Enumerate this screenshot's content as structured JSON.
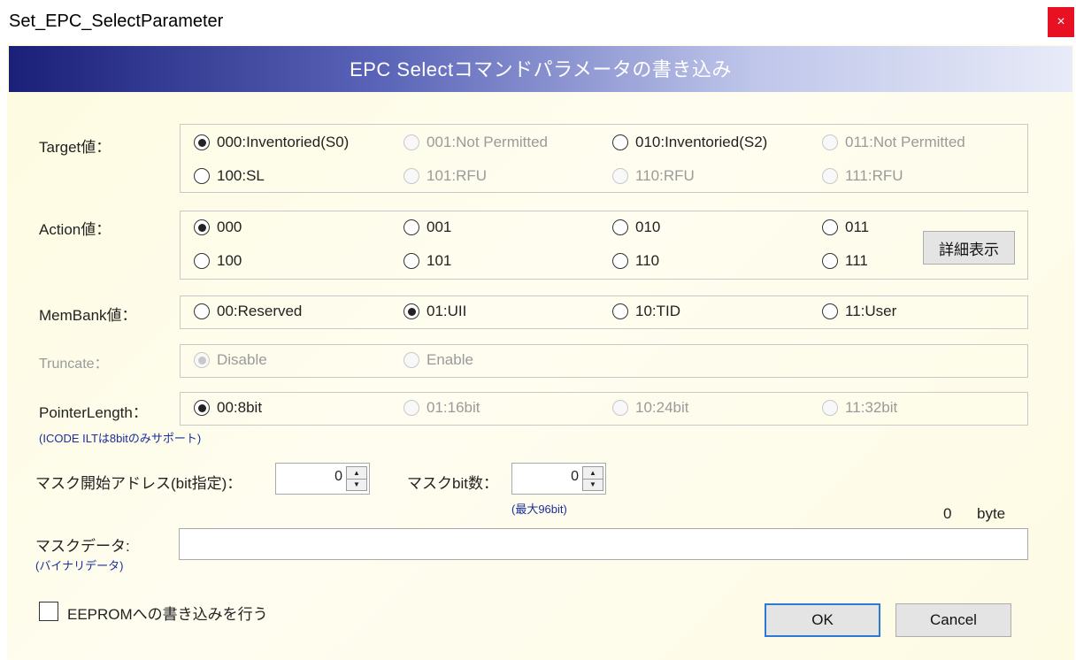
{
  "window": {
    "title": "Set_EPC_SelectParameter",
    "close_label": "×"
  },
  "header": {
    "title": "EPC Selectコマンドパラメータの書き込み"
  },
  "target": {
    "label": "Target値：",
    "options": [
      "000:Inventoried(S0)",
      "001:Not Permitted",
      "010:Inventoried(S2)",
      "011:Not Permitted",
      "100:SL",
      "101:RFU",
      "110:RFU",
      "111:RFU"
    ],
    "selected": "000:Inventoried(S0)"
  },
  "action": {
    "label": "Action値：",
    "options": [
      "000",
      "001",
      "010",
      "011",
      "100",
      "101",
      "110",
      "111"
    ],
    "selected": "000",
    "detail_button": "詳細表示"
  },
  "membank": {
    "label": "MemBank値：",
    "options": [
      "00:Reserved",
      "01:UII",
      "10:TID",
      "11:User"
    ],
    "selected": "01:UII"
  },
  "truncate": {
    "label": "Truncate：",
    "options": [
      "Disable",
      "Enable"
    ],
    "selected": "Disable"
  },
  "pointer_length": {
    "label": "PointerLength：",
    "options": [
      "00:8bit",
      "01:16bit",
      "10:24bit",
      "11:32bit"
    ],
    "selected": "00:8bit",
    "note": "(ICODE ILTは8bitのみサポート)"
  },
  "mask_start": {
    "label": "マスク開始アドレス(bit指定)：",
    "value": "0"
  },
  "mask_bits": {
    "label": "マスクbit数：",
    "value": "0",
    "note": "(最大96bit)"
  },
  "mask_data": {
    "label": "マスクデータ:",
    "sublabel": "(バイナリデータ)",
    "value": "",
    "byte_count": "0",
    "byte_unit": "byte"
  },
  "eeprom": {
    "label": "EEPROMへの書き込みを行う",
    "checked": false
  },
  "buttons": {
    "ok": "OK",
    "cancel": "Cancel"
  }
}
